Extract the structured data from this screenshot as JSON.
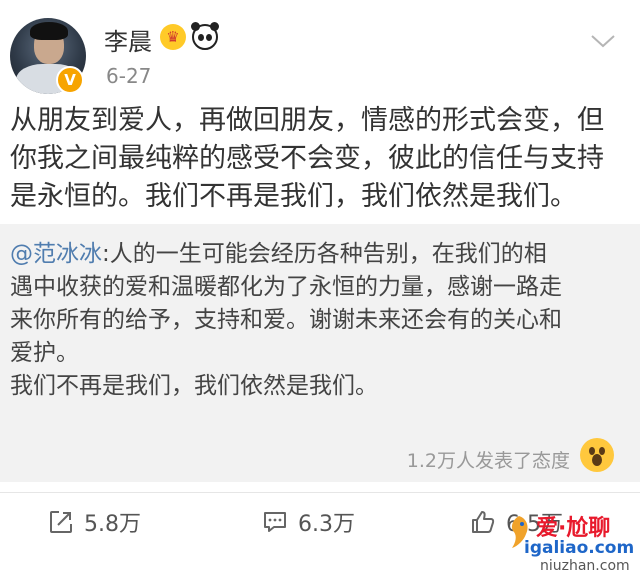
{
  "post": {
    "author": "李晨",
    "date": "6-27",
    "verified_badge": "V",
    "badges": [
      "crown-icon",
      "panda-icon"
    ],
    "content_lines": [
      "从朋友到爱人，再做回朋友，情感的形式会变，但",
      "你我之间最纯粹的感受不会变，彼此的信任与支持",
      "是永恒的。我们不再是我们，我们依然是我们。"
    ]
  },
  "quote": {
    "mention": "@范冰冰",
    "lines": [
      ":人的一生可能会经历各种告别，在我们的相",
      "遇中收获的爱和温暖都化为了永恒的力量，感谢一路走",
      "来你所有的给予，支持和爱。谢谢未来还会有的关心和",
      "爱护。",
      "我们不再是我们，我们依然是我们。"
    ],
    "reactions_text": "1.2万人发表了态度"
  },
  "actions": {
    "repost": "5.8万",
    "comment": "6.3万",
    "like": "6.5万"
  },
  "watermark": {
    "line1": "爱·尬聊",
    "line2": "igaliao.com",
    "line3": "niuzhan.com"
  },
  "colors": {
    "mention": "#507daf",
    "quote_bg": "#f2f2f2",
    "verified": "#f7a400",
    "watermark_red": "#e8192c",
    "watermark_blue": "#1e66c8"
  }
}
